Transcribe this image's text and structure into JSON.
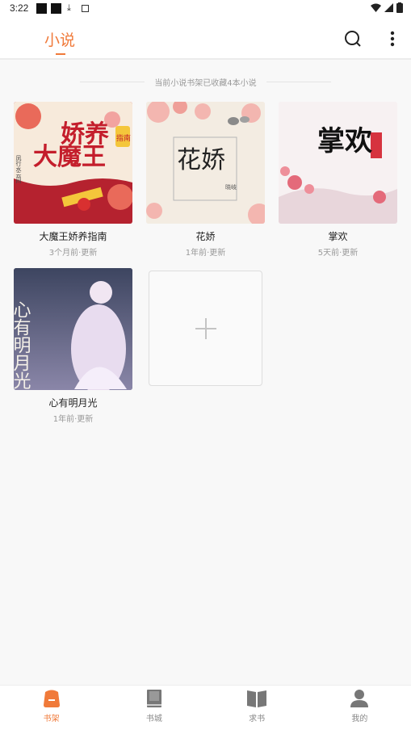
{
  "status_bar": {
    "time": "3:22"
  },
  "header": {
    "title": "小说"
  },
  "shelf_info": "当前小说书架已收藏4本小说",
  "books": [
    {
      "title": "大魔王娇养指南",
      "meta": "3个月前·更新",
      "cover": {
        "big_text": "大魔王",
        "sub_text": "娇养",
        "tag": "指南",
        "author": "凤行水云间",
        "bg": "#c8283a"
      }
    },
    {
      "title": "花娇",
      "meta": "1年前·更新",
      "cover": {
        "big_text": "花娇",
        "author": "晓岐",
        "bg": "#f3ece2"
      }
    },
    {
      "title": "掌欢",
      "meta": "5天前·更新",
      "cover": {
        "big_text": "掌欢",
        "bg": "#f5eef0"
      }
    },
    {
      "title": "心有明月光",
      "meta": "1年前·更新",
      "cover": {
        "big_text": "心有明月光",
        "bg": "#6a6a86"
      }
    }
  ],
  "nav": [
    {
      "label": "书架",
      "icon": "bookshelf-icon",
      "active": true
    },
    {
      "label": "书城",
      "icon": "book-icon",
      "active": false
    },
    {
      "label": "求书",
      "icon": "open-book-icon",
      "active": false
    },
    {
      "label": "我的",
      "icon": "user-icon",
      "active": false
    }
  ],
  "colors": {
    "accent": "#f07a3a"
  }
}
